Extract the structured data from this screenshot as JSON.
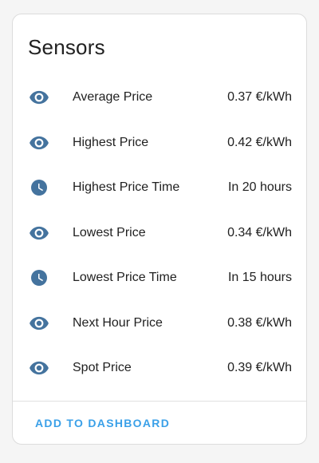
{
  "card": {
    "title": "Sensors",
    "action_label": "ADD TO DASHBOARD"
  },
  "colors": {
    "icon": "#44739e",
    "accent": "#3aa0e8",
    "text": "#212121"
  },
  "rows": [
    {
      "icon": "eye-icon",
      "label": "Average Price",
      "value": "0.37 €/kWh"
    },
    {
      "icon": "eye-icon",
      "label": "Highest Price",
      "value": "0.42 €/kWh"
    },
    {
      "icon": "clock-icon",
      "label": "Highest Price Time",
      "value": "In 20 hours"
    },
    {
      "icon": "eye-icon",
      "label": "Lowest Price",
      "value": "0.34 €/kWh"
    },
    {
      "icon": "clock-icon",
      "label": "Lowest Price Time",
      "value": "In 15 hours"
    },
    {
      "icon": "eye-icon",
      "label": "Next Hour Price",
      "value": "0.38 €/kWh"
    },
    {
      "icon": "eye-icon",
      "label": "Spot Price",
      "value": "0.39 €/kWh"
    }
  ]
}
